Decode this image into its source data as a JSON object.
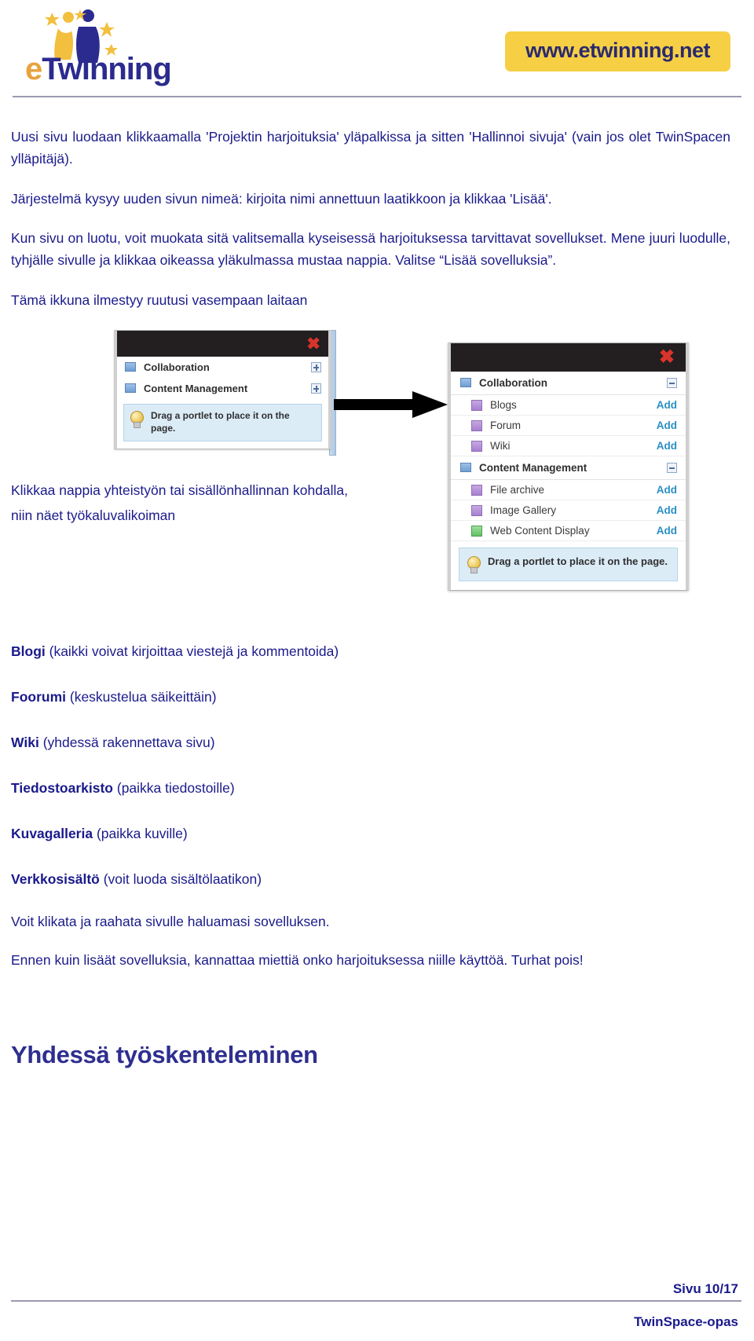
{
  "header": {
    "logo_e": "e",
    "logo_twinning": "Twinning",
    "url_badge": "www.etwinning.net"
  },
  "intro": {
    "p1": "Uusi sivu luodaan klikkaamalla 'Projektin harjoituksia' yläpalkissa ja sitten 'Hallinnoi sivuja' (vain jos olet TwinSpacen ylläpitäjä).",
    "p2": "Järjestelmä kysyy uuden sivun nimeä: kirjoita nimi annettuun laatikkoon ja klikkaa 'Lisää'.",
    "p3": "Kun sivu on luotu, voit muokata sitä valitsemalla kyseisessä harjoituksessa tarvittavat sovellukset. Mene juuri luodulle, tyhjälle sivulle ja klikkaa oikeassa yläkulmassa mustaa nappia. Valitse “Lisää sovelluksia”.",
    "p4": "Tämä ikkuna ilmestyy ruutusi vasempaan laitaan"
  },
  "figure": {
    "caption_left_line1": "Klikkaa nappia yhteistyön tai sisällönhallinnan kohdalla,",
    "caption_left_line2": "niin näet työkaluvalikoiman",
    "left_panel": {
      "categories": [
        {
          "label": "Collaboration",
          "state": "collapsed"
        },
        {
          "label": "Content Management",
          "state": "collapsed"
        }
      ],
      "drag_hint": "Drag a portlet to place it on the page."
    },
    "right_panel": {
      "groups": [
        {
          "label": "Collaboration",
          "state": "expanded",
          "items": [
            {
              "label": "Blogs",
              "action": "Add",
              "color": "purple"
            },
            {
              "label": "Forum",
              "action": "Add",
              "color": "purple"
            },
            {
              "label": "Wiki",
              "action": "Add",
              "color": "purple"
            }
          ]
        },
        {
          "label": "Content Management",
          "state": "expanded",
          "items": [
            {
              "label": "File archive",
              "action": "Add",
              "color": "purple"
            },
            {
              "label": "Image Gallery",
              "action": "Add",
              "color": "purple"
            },
            {
              "label": "Web Content Display",
              "action": "Add",
              "color": "green"
            }
          ]
        }
      ],
      "drag_hint": "Drag a portlet to place it on the page."
    }
  },
  "features": [
    {
      "name": "Blogi",
      "desc": " (kaikki voivat kirjoittaa viestejä ja kommentoida)"
    },
    {
      "name": "Foorumi",
      "desc": " (keskustelua säikeittäin)"
    },
    {
      "name": "Wiki",
      "desc": " (yhdessä rakennettava sivu)"
    },
    {
      "name": "Tiedostoarkisto",
      "desc": " (paikka tiedostoille)"
    },
    {
      "name": "Kuvagalleria",
      "desc": " (paikka kuville)"
    },
    {
      "name": "Verkkosisältö",
      "desc": " (voit luoda sisältölaatikon)"
    }
  ],
  "closing": {
    "p1": "Voit klikata ja raahata sivulle haluamasi sovelluksen.",
    "p2": "Ennen kuin lisäät sovelluksia, kannattaa miettiä onko harjoituksessa niille käyttöä. Turhat pois!"
  },
  "section_title": "Yhdessä työskenteleminen",
  "footer": {
    "page_number": "Sivu 10/17",
    "doc_title": "TwinSpace-opas"
  },
  "colors": {
    "text_blue": "#1a1a8c",
    "badge_yellow": "#f6cf45",
    "add_link_blue": "#2a8fc4",
    "close_red": "#d9342b"
  }
}
